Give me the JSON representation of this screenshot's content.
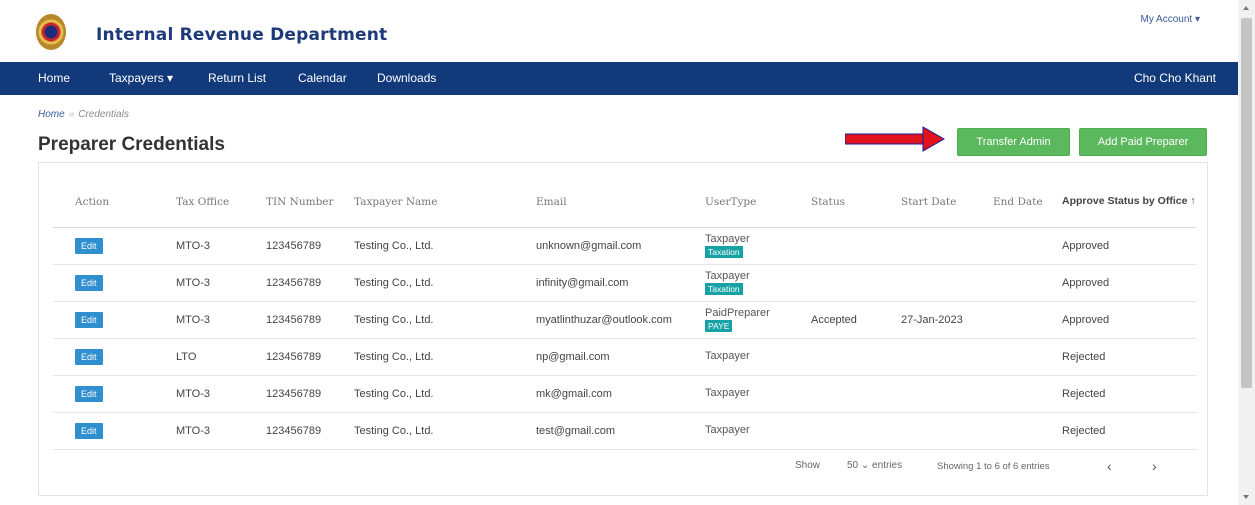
{
  "header": {
    "brand": "Internal Revenue Department",
    "my_account": "My Account ▾"
  },
  "nav": {
    "items": [
      "Home",
      "Taxpayers ▾",
      "Return List",
      "Calendar",
      "Downloads"
    ],
    "user": "Cho Cho Khant"
  },
  "breadcrumb": {
    "home": "Home",
    "sep": "»",
    "current": "Credentials"
  },
  "page_title": "Preparer Credentials",
  "buttons": {
    "transfer_admin": "Transfer Admin",
    "add_paid_preparer": "Add Paid Preparer"
  },
  "colors": {
    "navbar": "#123a7a",
    "green_button": "#5cb85c",
    "edit_button": "#2f8fcf",
    "tag": "#17a2a5",
    "arrow": "#e0121b"
  },
  "table": {
    "headers": [
      "Action",
      "Tax Office",
      "TIN Number",
      "Taxpayer Name",
      "Email",
      "UserType",
      "Status",
      "Start Date",
      "End Date",
      "Approve Status by Office ↑"
    ],
    "rows": [
      {
        "action": "Edit",
        "office": "MTO-3",
        "tin": "123456789",
        "name": "Testing Co., Ltd.",
        "email": "unknown@gmail.com",
        "usertype": "Taxpayer",
        "tag": "Taxation",
        "status": "",
        "start": "",
        "end": "",
        "approve": "Approved"
      },
      {
        "action": "Edit",
        "office": "MTO-3",
        "tin": "123456789",
        "name": "Testing Co., Ltd.",
        "email": "infinity@gmail.com",
        "usertype": "Taxpayer",
        "tag": "Taxation",
        "status": "",
        "start": "",
        "end": "",
        "approve": "Approved"
      },
      {
        "action": "Edit",
        "office": "MTO-3",
        "tin": "123456789",
        "name": "Testing Co., Ltd.",
        "email": "myatlinthuzar@outlook.com",
        "usertype": "PaidPreparer",
        "tag": "PAYE",
        "status": "Accepted",
        "start": "27-Jan-2023",
        "end": "",
        "approve": "Approved"
      },
      {
        "action": "Edit",
        "office": "LTO",
        "tin": "123456789",
        "name": "Testing Co., Ltd.",
        "email": "np@gmail.com",
        "usertype": "Taxpayer",
        "tag": "",
        "status": "",
        "start": "",
        "end": "",
        "approve": "Rejected"
      },
      {
        "action": "Edit",
        "office": "MTO-3",
        "tin": "123456789",
        "name": "Testing Co., Ltd.",
        "email": "mk@gmail.com",
        "usertype": "Taxpayer",
        "tag": "",
        "status": "",
        "start": "",
        "end": "",
        "approve": "Rejected"
      },
      {
        "action": "Edit",
        "office": "MTO-3",
        "tin": "123456789",
        "name": "Testing Co., Ltd.",
        "email": "test@gmail.com",
        "usertype": "Taxpayer",
        "tag": "",
        "status": "",
        "start": "",
        "end": "",
        "approve": "Rejected"
      }
    ]
  },
  "footer": {
    "show": "Show",
    "entries_select": "50 ⌄ entries",
    "info": "Showing 1 to 6 of 6 entries",
    "prev": "‹",
    "next": "›"
  }
}
